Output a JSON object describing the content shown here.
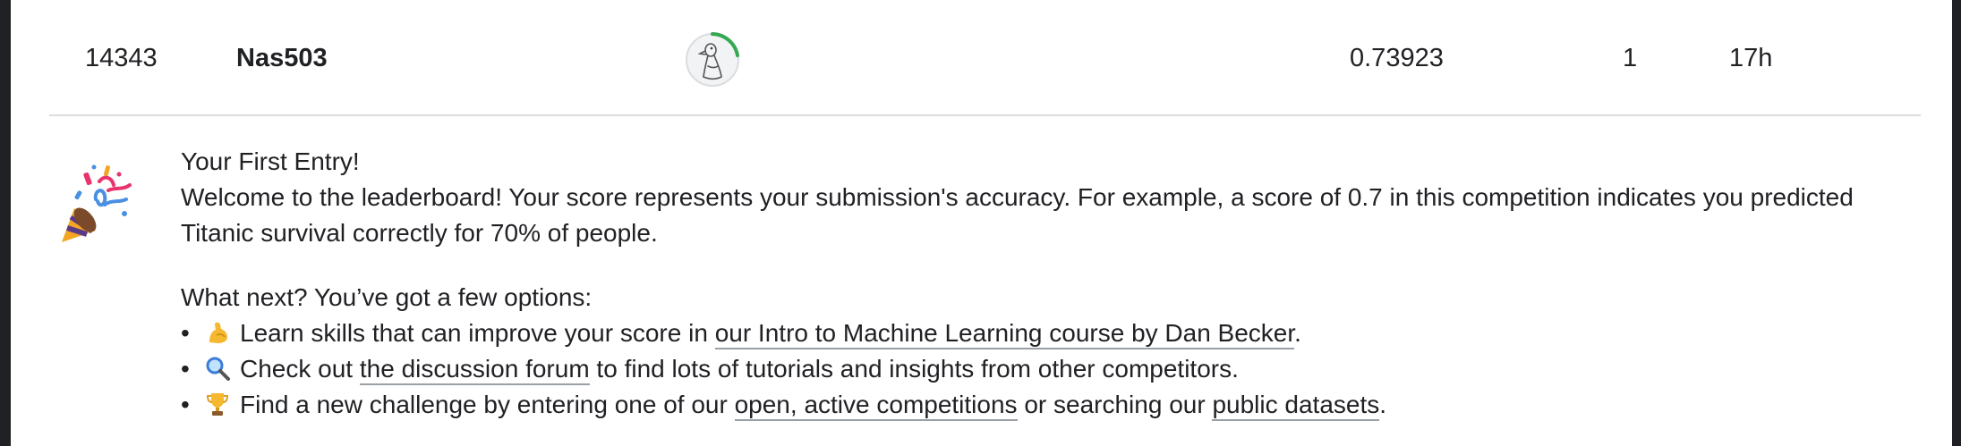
{
  "leaderboard_row": {
    "rank": "14343",
    "team_name": "Nas503",
    "score": "0.73923",
    "entries": "1",
    "last": "17h"
  },
  "first_entry": {
    "title": "Your First Entry!",
    "welcome_text": "Welcome to the leaderboard! Your score represents your submission's accuracy. For example, a score of 0.7 in this competition indicates you predicted Titanic survival correctly for 70% of people.",
    "next_heading": "What next? You’ve got a few options:",
    "options": [
      {
        "icon": "flexed-biceps-icon",
        "pre": "Learn skills that can improve your score in ",
        "link1": "our Intro to Machine Learning course by Dan Becker",
        "post": "."
      },
      {
        "icon": "magnifying-glass-icon",
        "pre": "Check out ",
        "link1": "the discussion forum",
        "post": " to find lots of tutorials and insights from other competitors."
      },
      {
        "icon": "trophy-icon",
        "pre": "Find a new challenge by entering one of our ",
        "link1": "open, active competitions",
        "mid": " or searching our ",
        "link2": "public datasets",
        "post": "."
      }
    ]
  },
  "colors": {
    "accent_green": "#34a853",
    "divider": "#dadce0",
    "link_underline": "#9aa0a6"
  }
}
